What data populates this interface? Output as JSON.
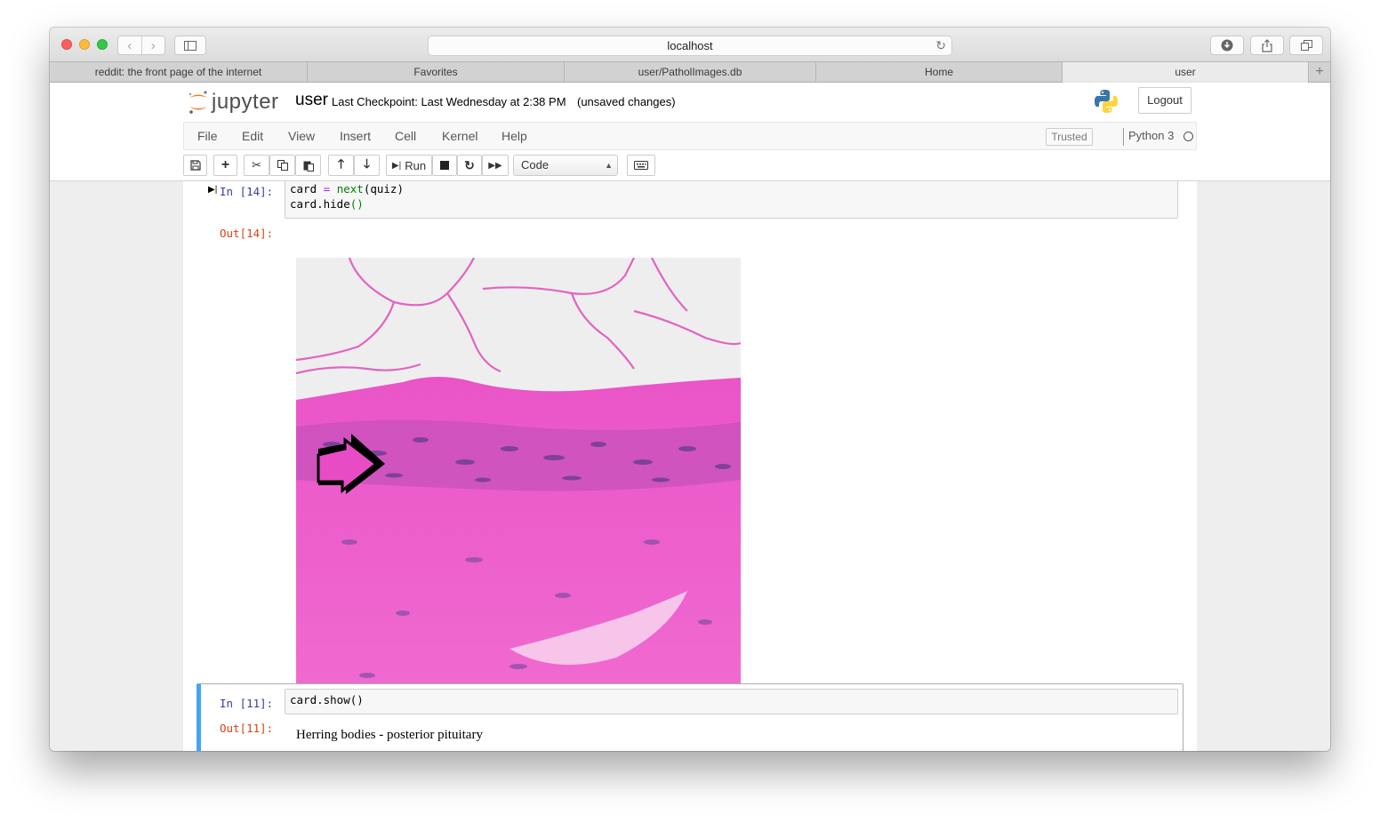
{
  "browser": {
    "url": "localhost",
    "tabs": [
      {
        "label": "reddit: the front page of the internet",
        "active": false
      },
      {
        "label": "Favorites",
        "active": false
      },
      {
        "label": "user/PatholImages.db",
        "active": false
      },
      {
        "label": "Home",
        "active": false
      },
      {
        "label": "user",
        "active": true
      }
    ]
  },
  "jupyter": {
    "logo_text": "jupyter",
    "notebook_name": "user",
    "checkpoint": "Last Checkpoint: Last Wednesday at 2:38 PM",
    "status": "(unsaved changes)",
    "logout_label": "Logout",
    "menu": [
      "File",
      "Edit",
      "View",
      "Insert",
      "Cell",
      "Kernel",
      "Help"
    ],
    "trusted_label": "Trusted",
    "kernel_name": "Python 3",
    "run_label": "Run",
    "cell_type": "Code"
  },
  "cells": [
    {
      "in_prompt": "In [14]:",
      "code_lines": [
        [
          "card ",
          "=",
          " ",
          "next",
          "(quiz)"
        ],
        [
          "card.hide",
          "()"
        ]
      ],
      "out_prompt": "Out[14]:",
      "output_image": "H&E stained histology micrograph with arrow"
    },
    {
      "in_prompt": "In [11]:",
      "code": "card.show()",
      "out_prompt": "Out[11]:",
      "output_text": "Herring bodies - posterior pituitary"
    }
  ],
  "colors": {
    "prompt_in": "#303f9f",
    "prompt_out": "#d84315",
    "selected_cell_accent": "#42a5f5",
    "jupyter_orange": "#f37626"
  }
}
